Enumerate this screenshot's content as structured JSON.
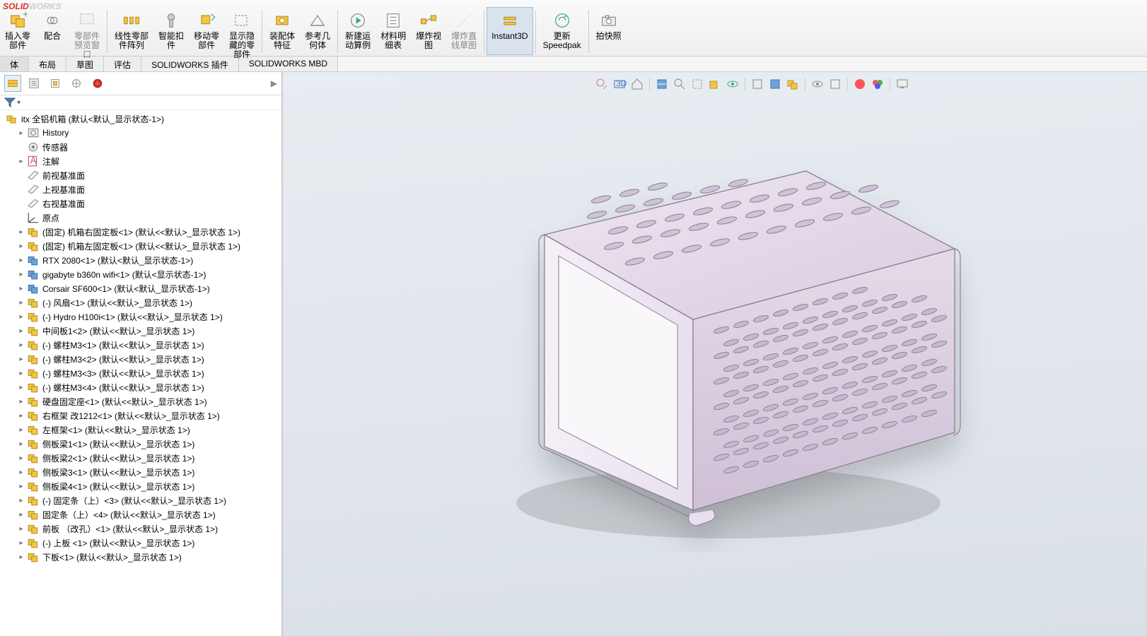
{
  "logo": {
    "text": "SOLIDWORKS"
  },
  "ribbon": {
    "items": [
      {
        "label": "插入零\n部件",
        "icon": "insert-component",
        "active": false
      },
      {
        "label": "配合",
        "icon": "mate"
      },
      {
        "label": "零部件\n预览窗\n口",
        "icon": "preview",
        "disabled": true
      },
      {
        "label": "线性零部\n件阵列",
        "icon": "linear-pattern"
      },
      {
        "label": "智能扣\n件",
        "icon": "smart-fastener"
      },
      {
        "label": "移动零\n部件",
        "icon": "move-component"
      },
      {
        "label": "显示隐\n藏的零\n部件",
        "icon": "show-hidden"
      },
      {
        "label": "装配体\n特征",
        "icon": "assembly-feature"
      },
      {
        "label": "参考几\n何体",
        "icon": "ref-geometry"
      },
      {
        "label": "新建运\n动算例",
        "icon": "motion-study"
      },
      {
        "label": "材料明\n细表",
        "icon": "bom"
      },
      {
        "label": "爆炸视\n图",
        "icon": "exploded-view"
      },
      {
        "label": "爆炸直\n线草图",
        "icon": "explode-line",
        "disabled": true
      },
      {
        "label": "Instant3D",
        "icon": "instant3d",
        "active": true
      },
      {
        "label": "更新\nSpeedpak",
        "icon": "speedpak"
      },
      {
        "label": "拍快照",
        "icon": "snapshot"
      }
    ]
  },
  "subtabs": [
    "体",
    "布局",
    "草图",
    "评估",
    "SOLIDWORKS 插件",
    "SOLIDWORKS MBD"
  ],
  "viewportIcons": [
    "search",
    "3d",
    "home",
    "section",
    "zoom",
    "sel",
    "bbox",
    "orbit",
    "edges",
    "shaded",
    "part",
    "eye",
    "p2",
    "appearance",
    "color",
    "screen"
  ],
  "tree": {
    "root": "itx  全铝机箱   (默认<默认_显示状态-1>)",
    "items": [
      {
        "icon": "history",
        "label": "History",
        "exp": true
      },
      {
        "icon": "sensor",
        "label": "传感器"
      },
      {
        "icon": "anno",
        "label": "注解",
        "exp": true
      },
      {
        "icon": "plane",
        "label": "前视基准面"
      },
      {
        "icon": "plane",
        "label": "上视基准面"
      },
      {
        "icon": "plane",
        "label": "右视基准面"
      },
      {
        "icon": "origin",
        "label": "原点"
      },
      {
        "icon": "part",
        "label": "(固定) 机箱右固定板<1> (默认<<默认>_显示状态 1>)",
        "exp": true
      },
      {
        "icon": "part",
        "label": "(固定) 机箱左固定板<1> (默认<<默认>_显示状态 1>)",
        "exp": true
      },
      {
        "icon": "blue",
        "label": "RTX 2080<1> (默认<默认_显示状态-1>)",
        "exp": true
      },
      {
        "icon": "blue",
        "label": "gigabyte b360n wifi<1> (默认<显示状态-1>)",
        "exp": true
      },
      {
        "icon": "blue",
        "label": "Corsair SF600<1> (默认<默认_显示状态-1>)",
        "exp": true
      },
      {
        "icon": "part",
        "label": "(-) 风扇<1> (默认<<默认>_显示状态 1>)",
        "exp": true
      },
      {
        "icon": "part",
        "label": "(-) Hydro H100i<1> (默认<<默认>_显示状态 1>)",
        "exp": true
      },
      {
        "icon": "part",
        "label": "中间板1<2> (默认<<默认>_显示状态 1>)",
        "exp": true
      },
      {
        "icon": "part",
        "label": "(-) 螺柱M3<1> (默认<<默认>_显示状态 1>)",
        "exp": true
      },
      {
        "icon": "part",
        "label": "(-) 螺柱M3<2> (默认<<默认>_显示状态 1>)",
        "exp": true
      },
      {
        "icon": "part",
        "label": "(-) 螺柱M3<3> (默认<<默认>_显示状态 1>)",
        "exp": true
      },
      {
        "icon": "part",
        "label": "(-) 螺柱M3<4> (默认<<默认>_显示状态 1>)",
        "exp": true
      },
      {
        "icon": "part",
        "label": "硬盘固定座<1> (默认<<默认>_显示状态 1>)",
        "exp": true
      },
      {
        "icon": "part",
        "label": "右框架 改1212<1> (默认<<默认>_显示状态 1>)",
        "exp": true
      },
      {
        "icon": "part",
        "label": "左框架<1> (默认<<默认>_显示状态 1>)",
        "exp": true
      },
      {
        "icon": "part",
        "label": "侧板梁1<1> (默认<<默认>_显示状态 1>)",
        "exp": true
      },
      {
        "icon": "part",
        "label": "侧板梁2<1> (默认<<默认>_显示状态 1>)",
        "exp": true
      },
      {
        "icon": "part",
        "label": "侧板梁3<1> (默认<<默认>_显示状态 1>)",
        "exp": true
      },
      {
        "icon": "part",
        "label": "侧板梁4<1> (默认<<默认>_显示状态 1>)",
        "exp": true
      },
      {
        "icon": "part",
        "label": "(-) 固定条（上）<3> (默认<<默认>_显示状态 1>)",
        "exp": true
      },
      {
        "icon": "part",
        "label": "固定条（上）<4> (默认<<默认>_显示状态 1>)",
        "exp": true
      },
      {
        "icon": "part",
        "label": "前板 （改孔）<1> (默认<<默认>_显示状态 1>)",
        "exp": true
      },
      {
        "icon": "part",
        "label": "(-) 上板 <1> (默认<<默认>_显示状态 1>)",
        "exp": true
      },
      {
        "icon": "part",
        "label": "下板<1> (默认<<默认>_显示状态 1>)",
        "exp": true
      }
    ]
  }
}
